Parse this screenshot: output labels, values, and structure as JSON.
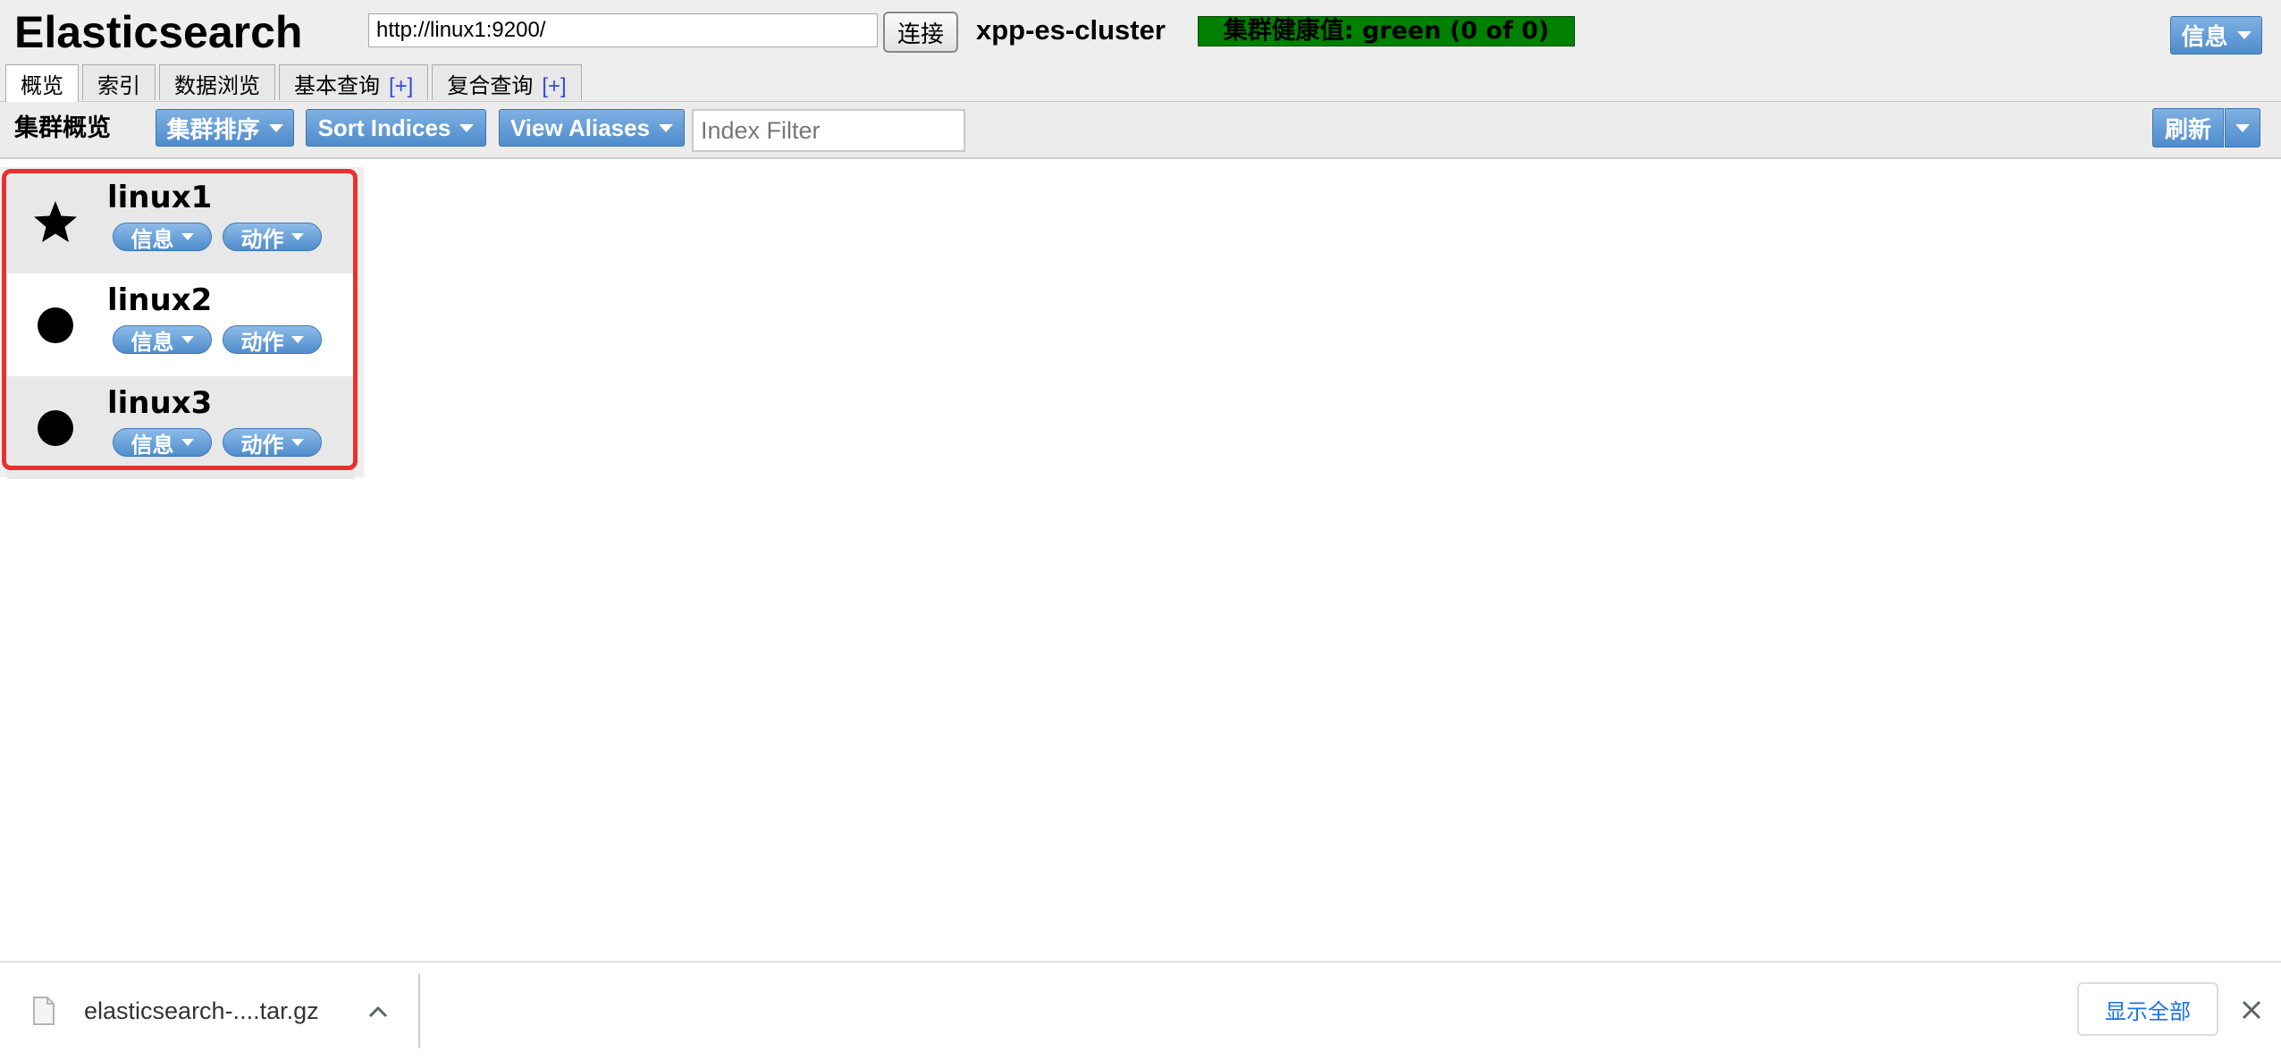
{
  "header": {
    "app_title": "Elasticsearch",
    "url_value": "http://linux1:9200/",
    "connect_label": "连接",
    "cluster_name": "xpp-es-cluster",
    "health_label": "集群健康值: green (0 of 0)",
    "health_color": "#008000",
    "info_label": "信息"
  },
  "tabs": [
    {
      "label": "概览",
      "active": true
    },
    {
      "label": "索引"
    },
    {
      "label": "数据浏览"
    },
    {
      "label": "基本查询",
      "plus": "[+]"
    },
    {
      "label": "复合查询",
      "plus": "[+]"
    }
  ],
  "toolbar": {
    "title": "集群概览",
    "sort_cluster_label": "集群排序",
    "sort_indices_label": "Sort Indices",
    "view_aliases_label": "View Aliases",
    "index_filter_placeholder": "Index Filter",
    "refresh_label": "刷新"
  },
  "nodes": [
    {
      "name": "linux1",
      "icon": "star-icon",
      "info_label": "信息",
      "action_label": "动作"
    },
    {
      "name": "linux2",
      "icon": "circle-icon",
      "info_label": "信息",
      "action_label": "动作"
    },
    {
      "name": "linux3",
      "icon": "circle-icon",
      "info_label": "信息",
      "action_label": "动作"
    }
  ],
  "download_bar": {
    "file_name": "elasticsearch-....tar.gz",
    "show_all_label": "显示全部"
  },
  "colors": {
    "button_blue": "#5b96d4",
    "highlight_red": "#e8312f",
    "link_blue": "#1a73e8"
  }
}
